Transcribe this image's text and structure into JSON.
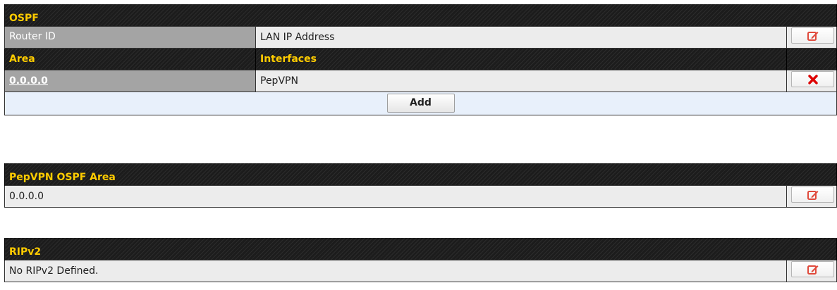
{
  "ospf": {
    "title": "OSPF",
    "router_id_label": "Router ID",
    "router_id_value": "LAN IP Address",
    "area_header": "Area",
    "interfaces_header": "Interfaces",
    "areas": [
      {
        "area": "0.0.0.0",
        "interfaces": "PepVPN"
      }
    ],
    "add_label": "Add"
  },
  "pepvpn": {
    "title": "PepVPN OSPF Area",
    "value": "0.0.0.0"
  },
  "rip": {
    "title": "RIPv2",
    "value": "No RIPv2 Defined."
  },
  "icons": {
    "edit": "edit-icon",
    "delete": "delete-icon"
  },
  "colors": {
    "header_text": "#ffcc00",
    "header_bg": "#1c1c1c",
    "edit_icon": "#e04a3c",
    "delete_icon": "#dd0000",
    "add_row_bg": "#e8f0fb"
  }
}
